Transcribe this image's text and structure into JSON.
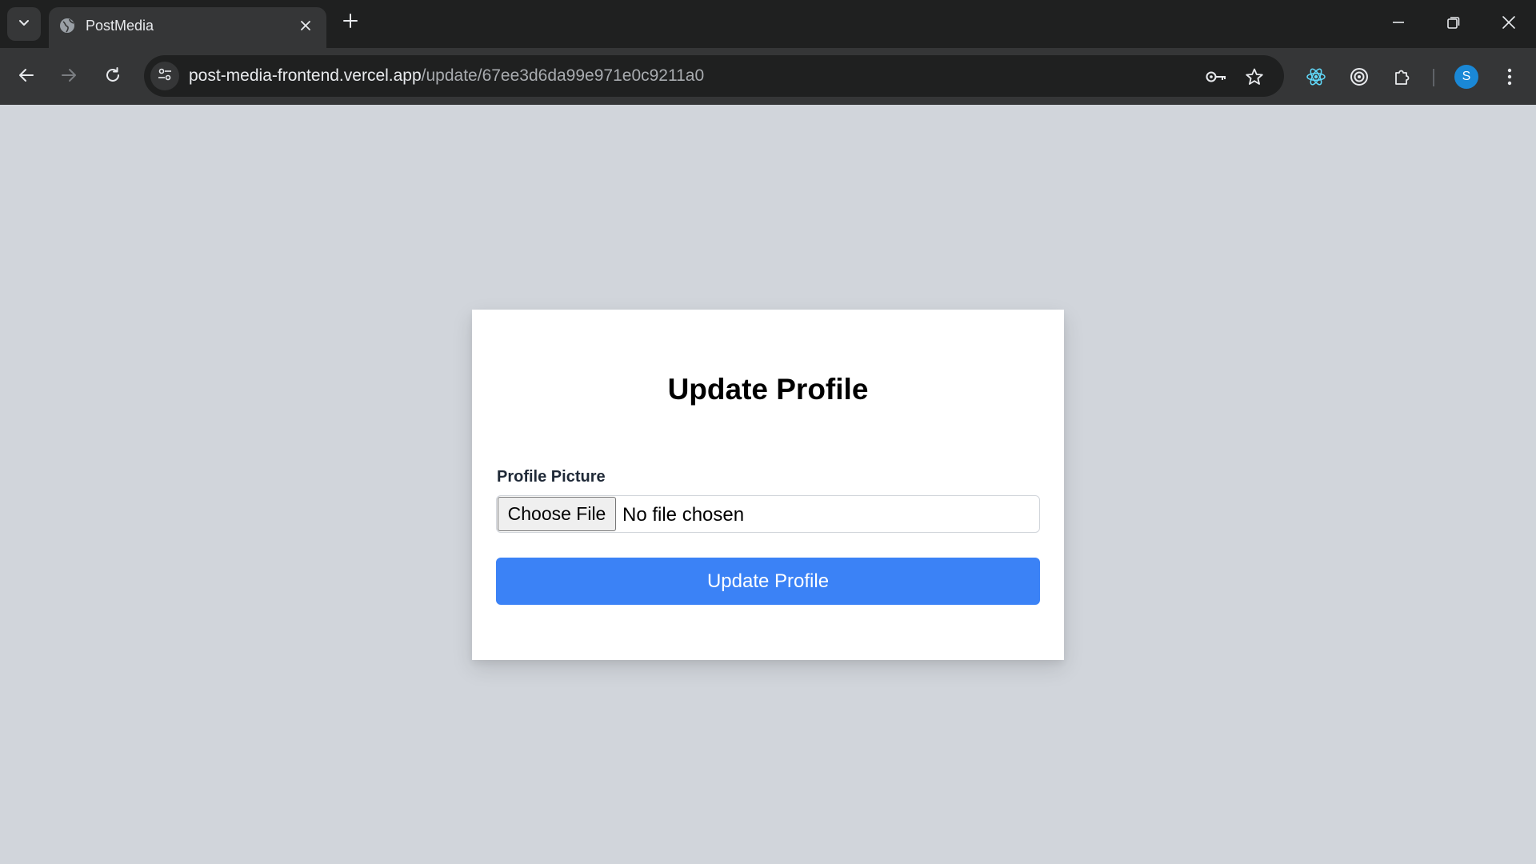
{
  "browser": {
    "tab": {
      "title": "PostMedia"
    },
    "address_bar": {
      "host": "post-media-frontend.vercel.app",
      "path": "/update/67ee3d6da99e971e0c9211a0"
    },
    "profile": {
      "initial": "S",
      "color": "#1a88d6"
    }
  },
  "page": {
    "title": "Update Profile",
    "form": {
      "profile_picture_label": "Profile Picture",
      "file_button_label": "Choose File",
      "file_status": "No file chosen",
      "submit_label": "Update Profile"
    },
    "colors": {
      "background": "#d1d5db",
      "card": "#ffffff",
      "primary_button": "#3b82f6"
    }
  }
}
